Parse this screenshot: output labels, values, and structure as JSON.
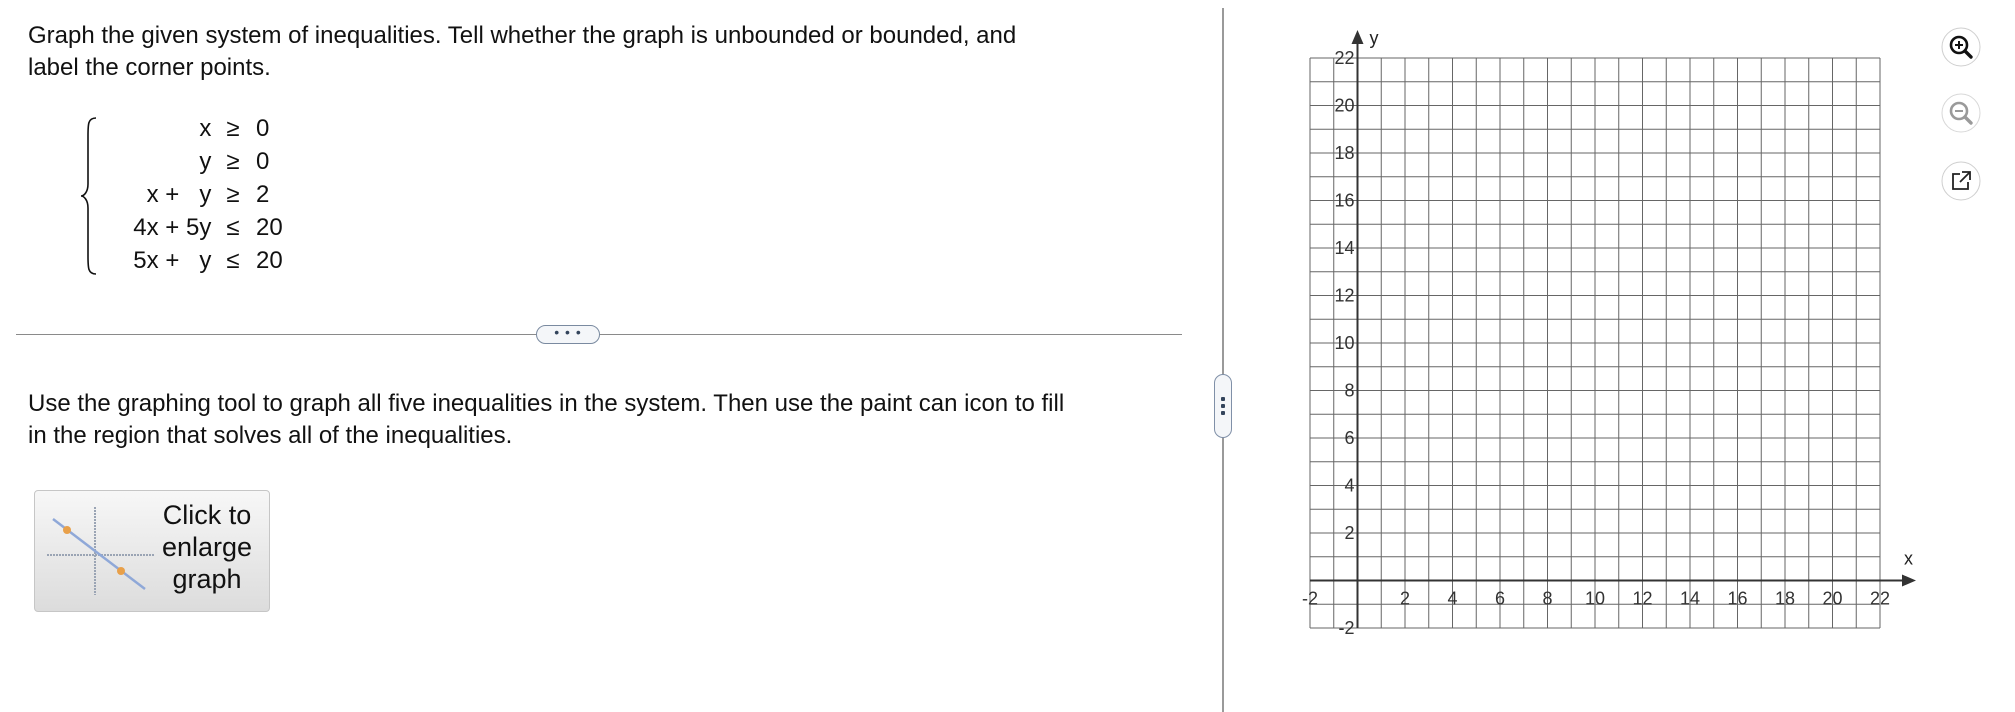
{
  "question": {
    "prompt": "Graph the given system of inequalities. Tell whether the graph is unbounded or bounded, and label the corner points.",
    "prompt_line1": "Graph the given system of inequalities. Tell whether the graph is unbounded or bounded, and",
    "prompt_line2": "label the corner points.",
    "system": [
      {
        "left": "x ",
        "relation": "≥",
        "right": "0"
      },
      {
        "left": "y ",
        "relation": "≥",
        "right": "0"
      },
      {
        "left": "x +   y ",
        "relation": "≥",
        "right": "2"
      },
      {
        "left": "4x + 5y ",
        "relation": "≤",
        "right": "20"
      },
      {
        "left": "5x +   y ",
        "relation": "≤",
        "right": "20"
      }
    ],
    "instruction_line1": "Use the graphing tool to graph all five inequalities in the system. Then use the paint can icon to fill",
    "instruction_line2": "in the region that solves all of the inequalities.",
    "expand_label": "• • •",
    "enlarge_button": {
      "line1": "Click to",
      "line2": "enlarge",
      "line3": "graph"
    }
  },
  "graph": {
    "x_axis_label": "x",
    "y_axis_label": "y",
    "x_range": [
      -2,
      22
    ],
    "y_range": [
      -2,
      22
    ],
    "grid_step": 1,
    "x_ticks": [
      "-2",
      "2",
      "4",
      "6",
      "8",
      "10",
      "12",
      "14",
      "16",
      "18",
      "20",
      "22"
    ],
    "y_ticks": [
      "22",
      "20",
      "18",
      "16",
      "14",
      "12",
      "10",
      "8",
      "6",
      "4",
      "2",
      "-2"
    ],
    "grid_color": "#666666",
    "axis_color": "#333333"
  },
  "toolbar": {
    "zoom_in_icon": "zoom-in-icon",
    "zoom_out_icon": "zoom-out-icon",
    "popout_icon": "external-link-icon"
  }
}
